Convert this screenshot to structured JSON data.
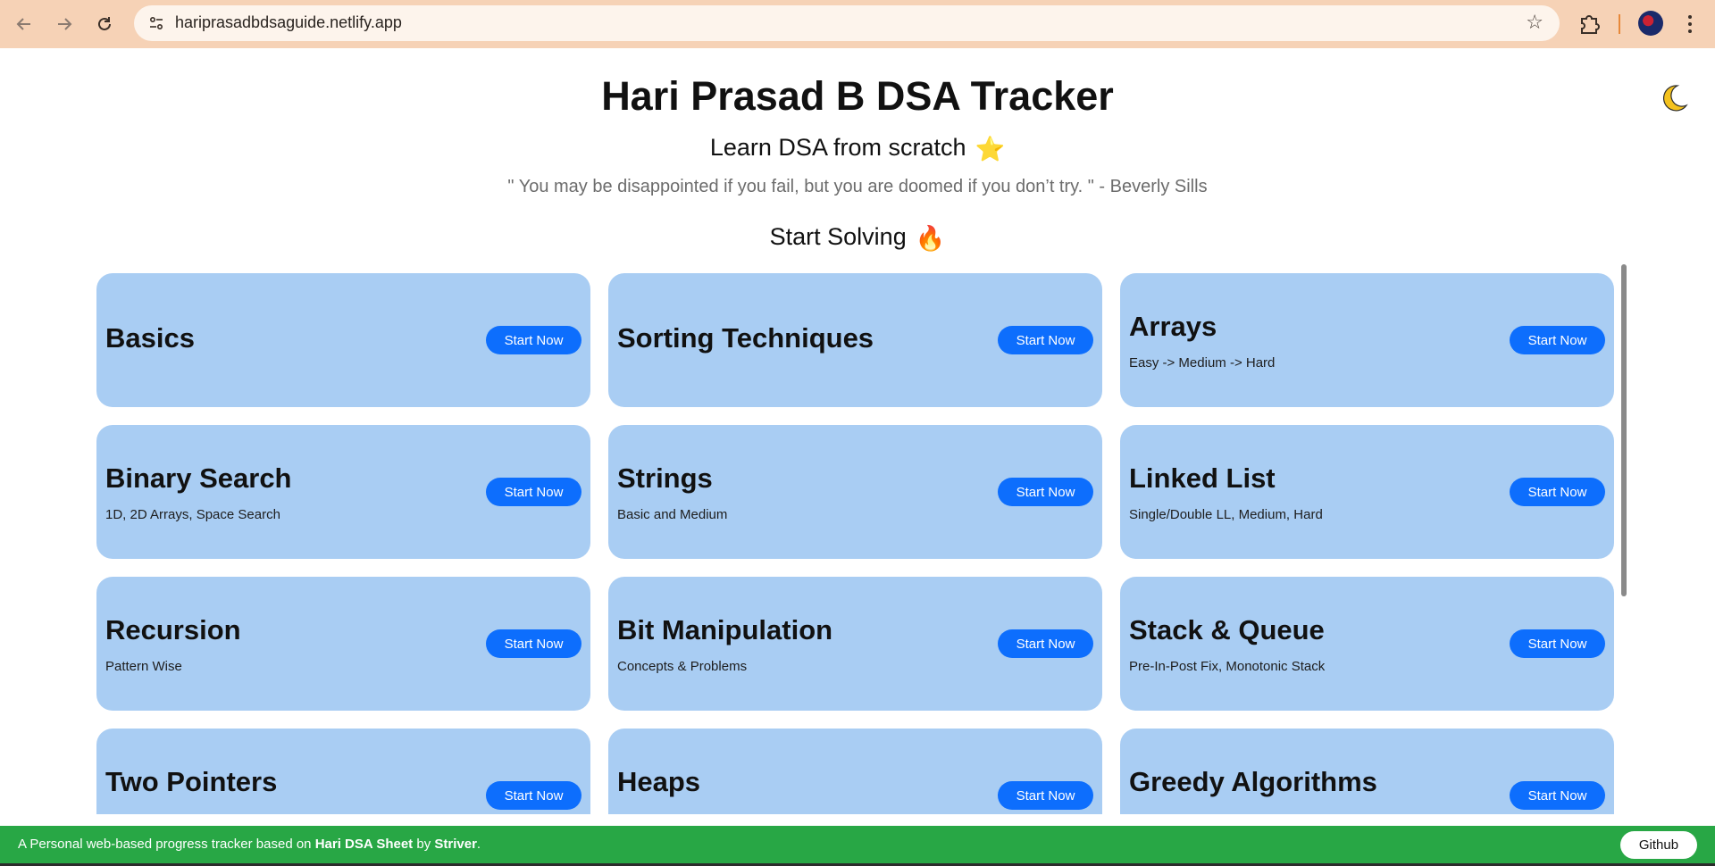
{
  "browser": {
    "url": "hariprasadbdsaguide.netlify.app",
    "colors": {
      "chrome": "#f6d2b6",
      "urlbar": "#fdf4ec"
    }
  },
  "header": {
    "title": "Hari Prasad B DSA Tracker",
    "subtitle": "Learn DSA from scratch",
    "subtitle_emoji": "⭐",
    "quote": "\" You may be disappointed if you fail, but you are doomed if you don’t try. \" - Beverly Sills",
    "section_title": "Start Solving",
    "section_emoji": "🔥"
  },
  "cards": [
    {
      "title": "Basics",
      "subtitle": "",
      "button": "Start Now"
    },
    {
      "title": "Sorting Techniques",
      "subtitle": "",
      "button": "Start Now"
    },
    {
      "title": "Arrays",
      "subtitle": "Easy -> Medium -> Hard",
      "button": "Start Now"
    },
    {
      "title": "Binary Search",
      "subtitle": "1D, 2D Arrays, Space Search",
      "button": "Start Now"
    },
    {
      "title": "Strings",
      "subtitle": "Basic and Medium",
      "button": "Start Now"
    },
    {
      "title": "Linked List",
      "subtitle": "Single/Double LL, Medium, Hard",
      "button": "Start Now"
    },
    {
      "title": "Recursion",
      "subtitle": "Pattern Wise",
      "button": "Start Now"
    },
    {
      "title": "Bit Manipulation",
      "subtitle": "Concepts & Problems",
      "button": "Start Now"
    },
    {
      "title": "Stack & Queue",
      "subtitle": "Pre-In-Post Fix, Monotonic Stack",
      "button": "Start Now"
    },
    {
      "title": "Two Pointers",
      "subtitle": "",
      "button": "Start Now"
    },
    {
      "title": "Heaps",
      "subtitle": "",
      "button": "Start Now"
    },
    {
      "title": "Greedy Algorithms",
      "subtitle": "",
      "button": "Start Now"
    }
  ],
  "footer": {
    "text_prefix": "A Personal web-based progress tracker based on ",
    "sheet_name": "Hari DSA Sheet",
    "text_by": " by ",
    "author": "Striver",
    "text_suffix": ".",
    "github_label": "Github"
  },
  "theme": {
    "card_bg": "#a9cdf3",
    "button_bg": "#0d6efd",
    "footer_bg": "#28a745"
  }
}
